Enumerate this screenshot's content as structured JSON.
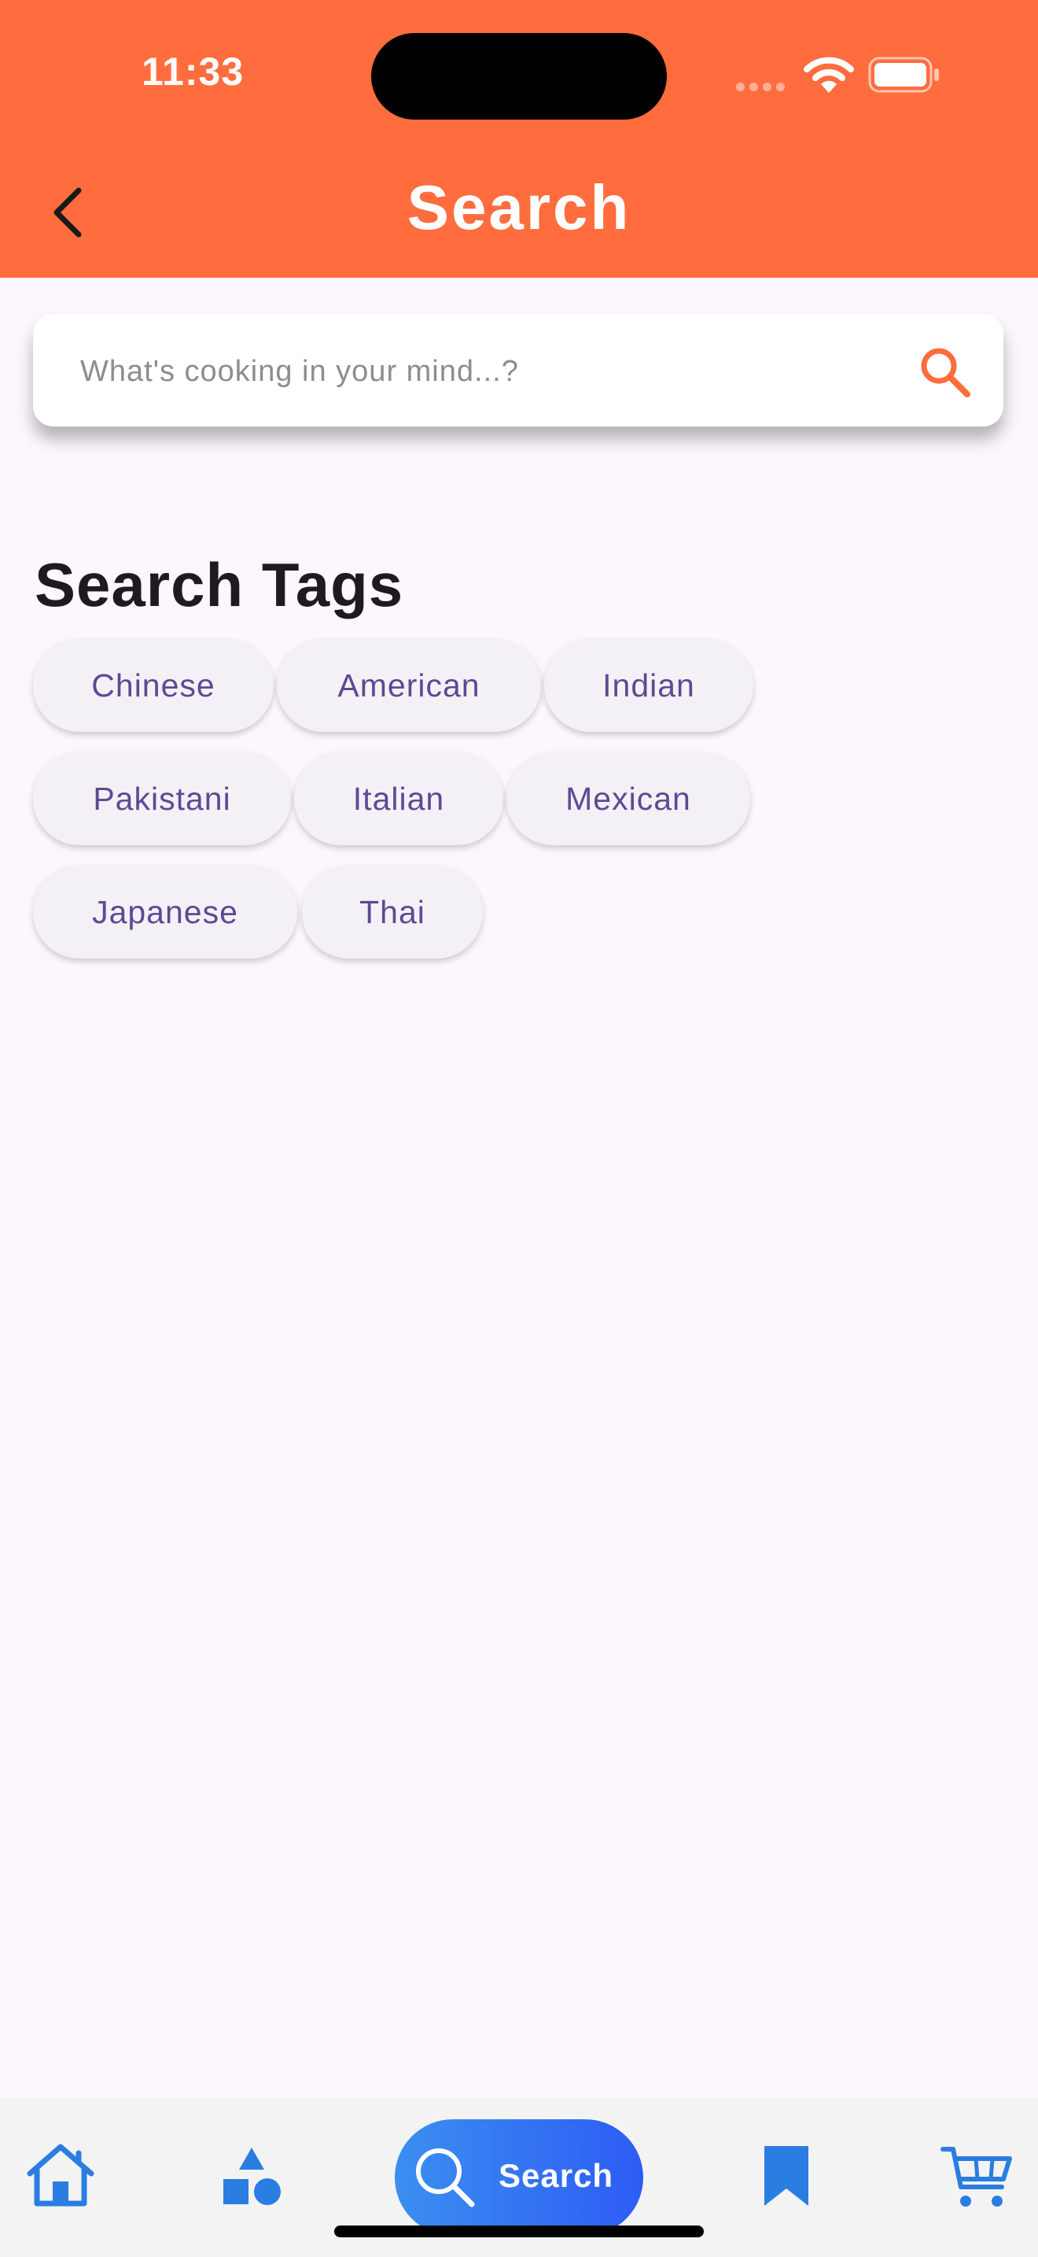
{
  "status_bar": {
    "time": "11:33"
  },
  "header": {
    "title": "Search"
  },
  "search": {
    "placeholder": "What's cooking in your mind...?"
  },
  "tags_section": {
    "title": "Search Tags",
    "tags": [
      "Chinese",
      "American",
      "Indian",
      "Pakistani",
      "Italian",
      "Mexican",
      "Japanese",
      "Thai"
    ]
  },
  "bottom_nav": {
    "items": [
      {
        "icon": "home-icon"
      },
      {
        "icon": "categories-icon"
      },
      {
        "icon": "search-icon",
        "label": "Search",
        "active": true
      },
      {
        "icon": "bookmark-icon"
      },
      {
        "icon": "cart-icon"
      }
    ]
  },
  "colors": {
    "header": "#ff6d3f",
    "accent": "#ff6d3f",
    "chip_text": "#5b4a94",
    "nav_icon": "#2a7de1",
    "nav_active_start": "#3b8ff0",
    "nav_active_end": "#2d5cf4"
  }
}
